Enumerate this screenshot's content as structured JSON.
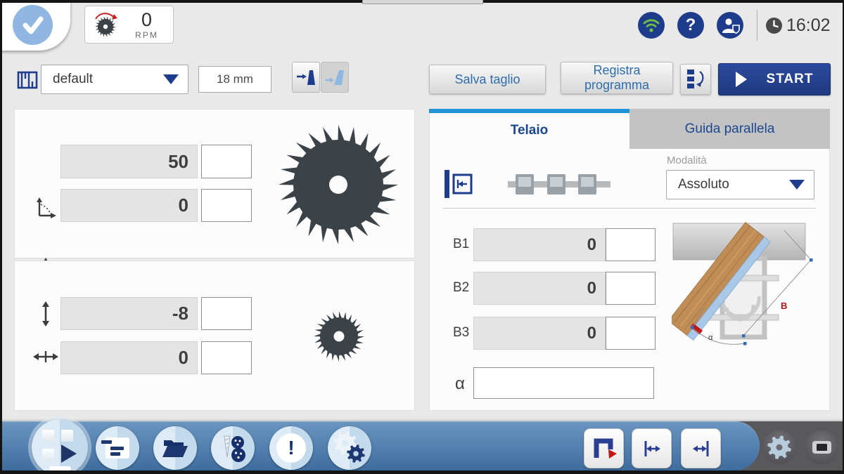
{
  "header": {
    "rpm_value": "0",
    "rpm_unit": "RPM",
    "time": "16:02"
  },
  "icons": {
    "help_glyph": "?",
    "alert_glyph": "!"
  },
  "setup": {
    "blade_profile": "default",
    "thickness": "18 mm"
  },
  "main_blade": {
    "height": "50",
    "angle": "0"
  },
  "scoring_blade": {
    "height": "-8",
    "offset": "0"
  },
  "actions": {
    "save_cut": "Salva taglio",
    "record_program": "Registra programma",
    "start": "START"
  },
  "tabs": {
    "telaio": "Telaio",
    "guida_parallela": "Guida parallela"
  },
  "frame": {
    "mode_label": "Modalità",
    "mode_value": "Assoluto",
    "fields": [
      {
        "label": "B1",
        "value": "0"
      },
      {
        "label": "B2",
        "value": "0"
      },
      {
        "label": "B3",
        "value": "0"
      }
    ],
    "alpha_label": "α",
    "alpha_value": "",
    "diagram": {
      "b_label": "B",
      "alpha_label": "α"
    }
  },
  "colors": {
    "navy": "#1d3c8b",
    "accent_blue": "#1e93d6",
    "toolbar_blue": "#4a7aab",
    "wifi_green": "#72c043",
    "alert_red": "#c41414",
    "blade_gray": "#3b4248"
  }
}
